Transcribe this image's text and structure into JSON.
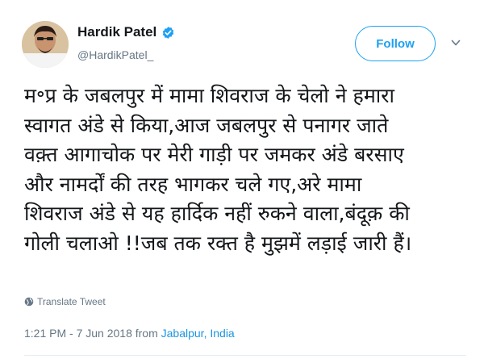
{
  "tweet": {
    "author": {
      "name": "Hardik Patel",
      "handle": "@HardikPatel_",
      "verified": true
    },
    "follow_label": "Follow",
    "text_lines": [
      "म॰प्र के जबलपुर में मामा शिवराज के चेलो ने हमारा",
      "स्वागत अंडे से किया,आज जबलपुर से पनागर जाते",
      "वक़्त आगाचोक पर मेरी गाड़ी पर जमकर अंडे बरसाए",
      "और नामर्दों की तरह भागकर चले गए,अरे मामा",
      "शिवराज अंडे से यह हार्दिक नहीं रुकने वाला,बंदूक़ की",
      "गोली चलाओ !!जब तक रक्त है मुझमें लड़ाई जारी हैं।"
    ],
    "translate_label": "Translate Tweet",
    "timestamp": "1:21 PM - 7 Jun 2018 from ",
    "location": "Jabalpur, India"
  },
  "icons": {
    "verified": "verified-badge-icon",
    "caret": "chevron-down-icon",
    "translate": "globe-icon"
  },
  "colors": {
    "accent": "#1da1f2",
    "link": "#1b95e0",
    "secondary_text": "#657786",
    "primary_text": "#14171a"
  }
}
